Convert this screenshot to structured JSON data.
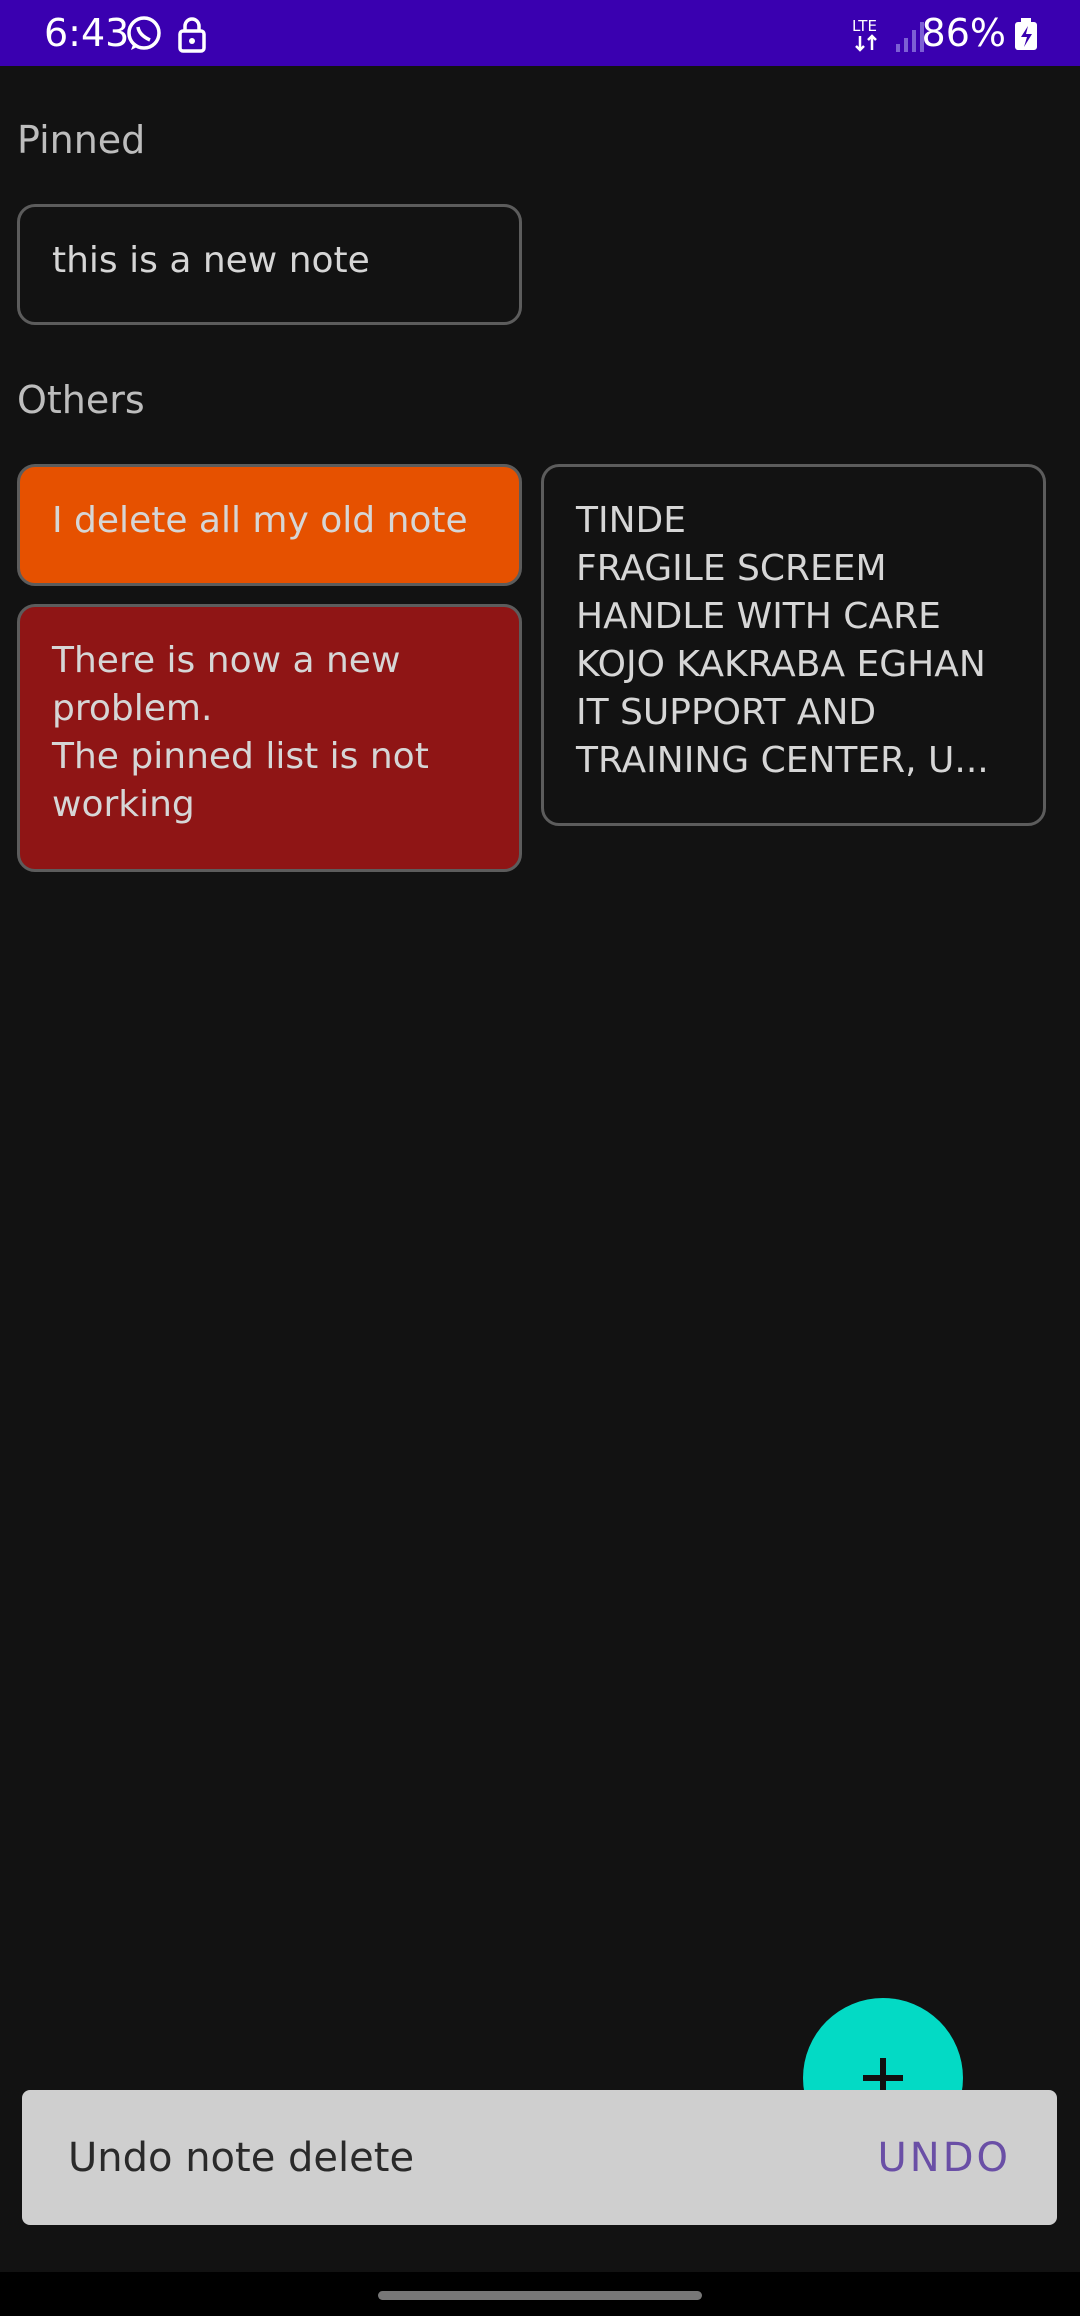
{
  "status_bar": {
    "time": "6:43",
    "battery": "86%",
    "icons": [
      "whatsapp-icon",
      "lock-icon",
      "lte-icon",
      "signal-icon",
      "battery-icon"
    ]
  },
  "sections": {
    "pinned": "Pinned",
    "others": "Others"
  },
  "pinned_notes": [
    {
      "text": "this is a new note",
      "color": "#121212"
    }
  ],
  "other_notes": [
    {
      "text": "I delete all my old note",
      "color": "#e65100"
    },
    {
      "text": "There is now a new\nproblem.\nThe pinned list is not\nworking",
      "color": "#8f1515"
    },
    {
      "text": "TINDE\nFRAGILE SCREEM\nHANDLE WITH CARE\nKOJO KAKRABA EGHAN\nIT SUPPORT AND\nTRAINING CENTER, U...",
      "color": "#121212"
    }
  ],
  "fab": {
    "icon": "plus-icon",
    "color": "#03dac5"
  },
  "snackbar": {
    "message": "Undo note delete",
    "action": "UNDO"
  }
}
